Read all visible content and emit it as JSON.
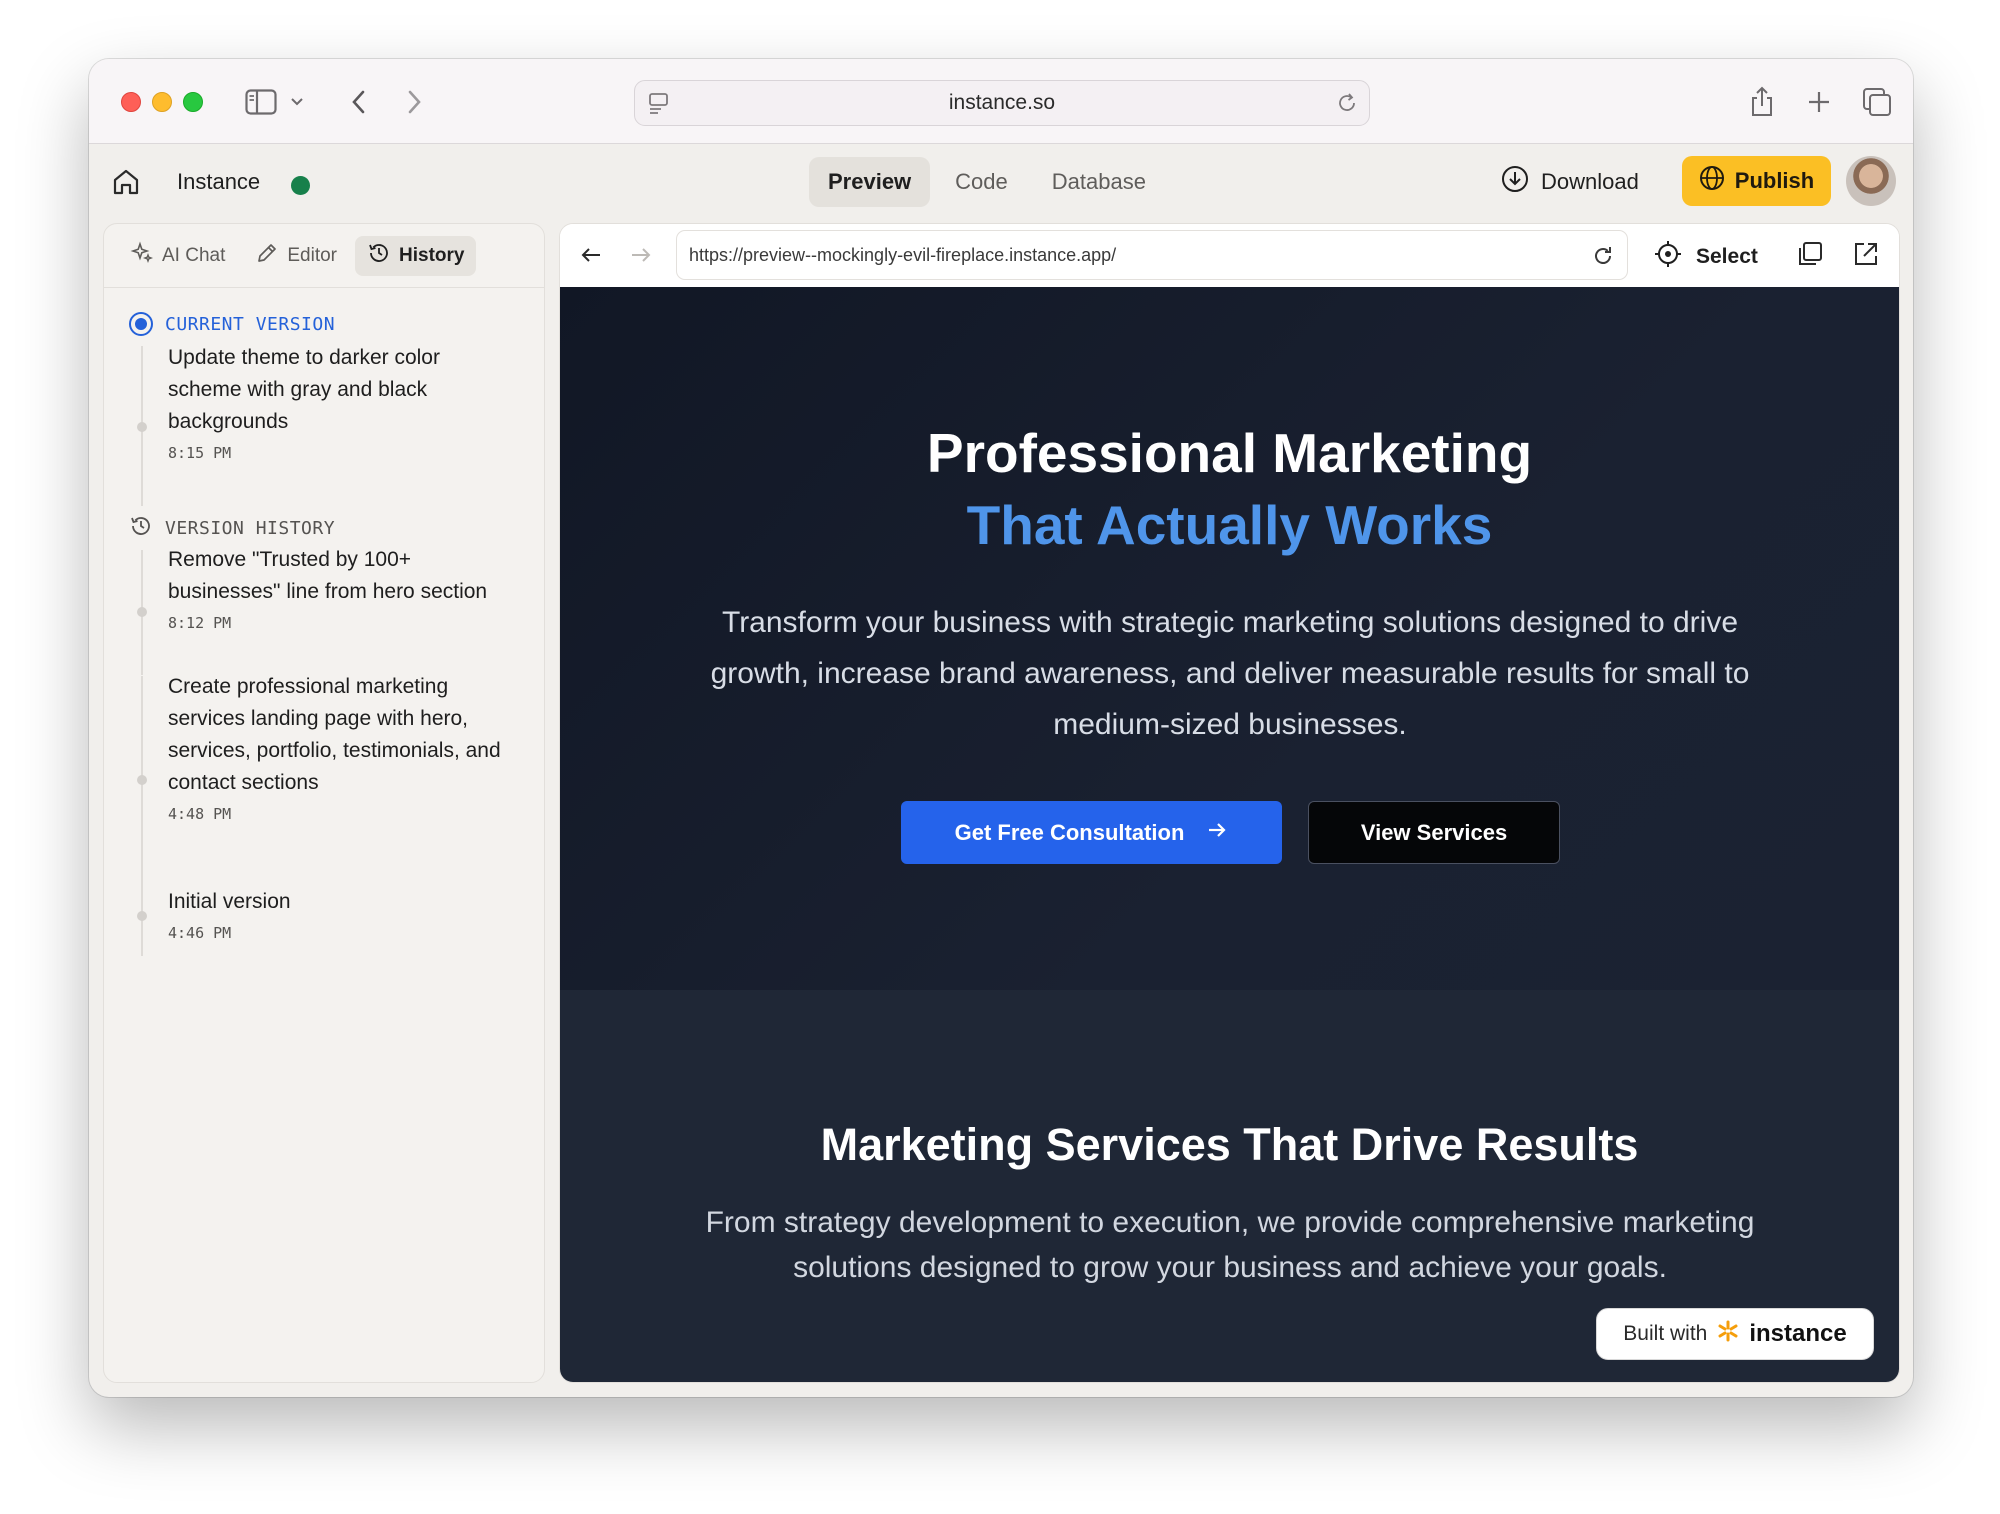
{
  "browser": {
    "url": "instance.so"
  },
  "app": {
    "name": "Instance",
    "status_color": "#17804b",
    "tabs": [
      {
        "label": "Preview",
        "active": true
      },
      {
        "label": "Code",
        "active": false
      },
      {
        "label": "Database",
        "active": false
      }
    ],
    "download_label": "Download",
    "publish_label": "Publish",
    "publish_color": "#fbbf24"
  },
  "sidebar": {
    "tabs": [
      {
        "label": "AI Chat",
        "icon": "sparkle-icon",
        "active": false
      },
      {
        "label": "Editor",
        "icon": "pencil-icon",
        "active": false
      },
      {
        "label": "History",
        "icon": "history-icon",
        "active": true
      }
    ],
    "current_heading": "CURRENT VERSION",
    "current_entry": {
      "message": "Update theme to darker color scheme with gray and black backgrounds",
      "time": "8:15 PM"
    },
    "history_heading": "VERSION HISTORY",
    "history_entries": [
      {
        "message": "Remove \"Trusted by 100+ businesses\" line from hero section",
        "time": "8:12 PM"
      },
      {
        "message": "Create professional marketing services landing page with hero, services, portfolio, testimonials, and contact sections",
        "time": "4:48 PM"
      },
      {
        "message": "Initial version",
        "time": "4:46 PM"
      }
    ]
  },
  "preview": {
    "url": "https://preview--mockingly-evil-fireplace.instance.app/",
    "select_label": "Select"
  },
  "site": {
    "hero_title": "Professional Marketing",
    "hero_title_accent": "That Actually Works",
    "hero_text": "Transform your business with strategic marketing solutions designed to drive growth, increase brand awareness, and deliver measurable results for small to medium-sized businesses.",
    "primary_cta": "Get Free Consultation",
    "secondary_cta": "View Services",
    "services_title": "Marketing Services That Drive Results",
    "services_text": "From strategy development to execution, we provide comprehensive marketing solutions designed to grow your business and achieve your goals.",
    "accent_color": "#4f95ea",
    "cta_color": "#2563eb"
  },
  "badge": {
    "prefix": "Built with",
    "brand": "instance"
  }
}
